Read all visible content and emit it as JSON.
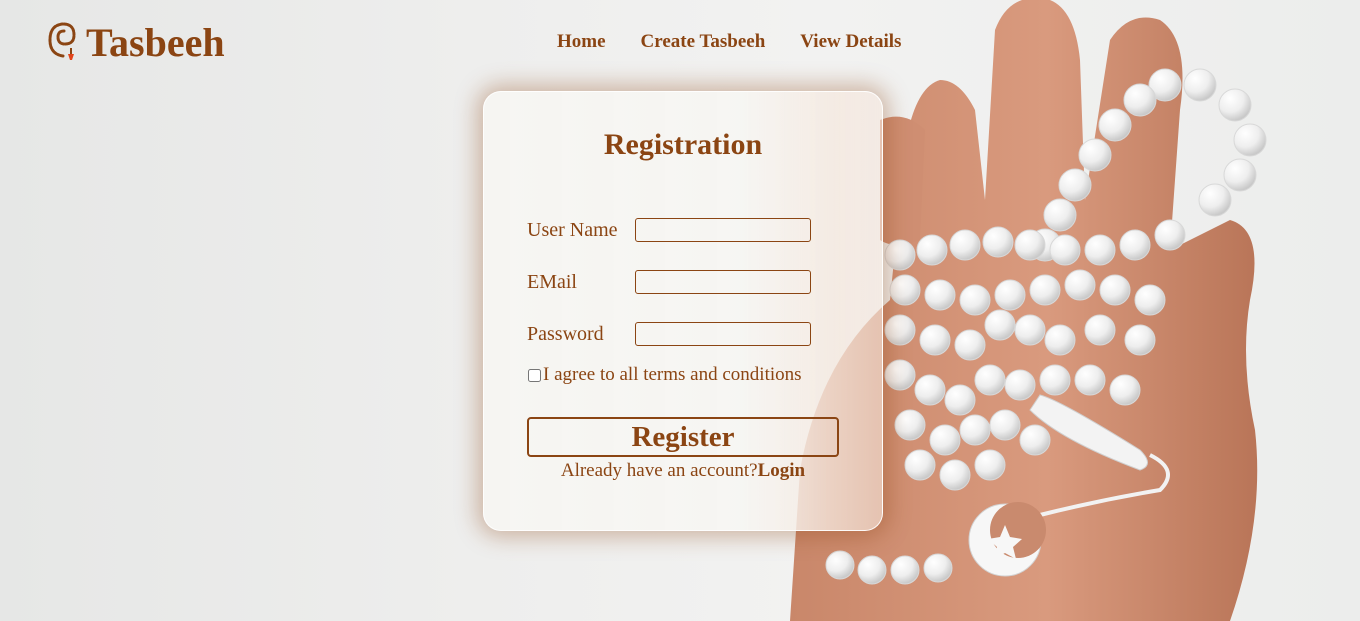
{
  "brand": {
    "logo_icon": "prayer-beads-icon",
    "name": "Tasbeeh"
  },
  "nav": {
    "items": [
      {
        "label": "Home"
      },
      {
        "label": "Create Tasbeeh"
      },
      {
        "label": "View Details"
      }
    ]
  },
  "form": {
    "title": "Registration",
    "fields": {
      "username": {
        "label": "User Name",
        "value": ""
      },
      "email": {
        "label": "EMail",
        "value": ""
      },
      "password": {
        "label": "Password",
        "value": ""
      }
    },
    "terms_label": "I agree to all terms and conditions",
    "terms_checked": false,
    "register_label": "Register",
    "login_prompt": "Already have an account?",
    "login_link": "Login"
  },
  "colors": {
    "accent": "#8b4513",
    "background": "#ededec",
    "card": "#f6f5f2"
  },
  "background_image": "hand-holding-white-prayer-beads"
}
